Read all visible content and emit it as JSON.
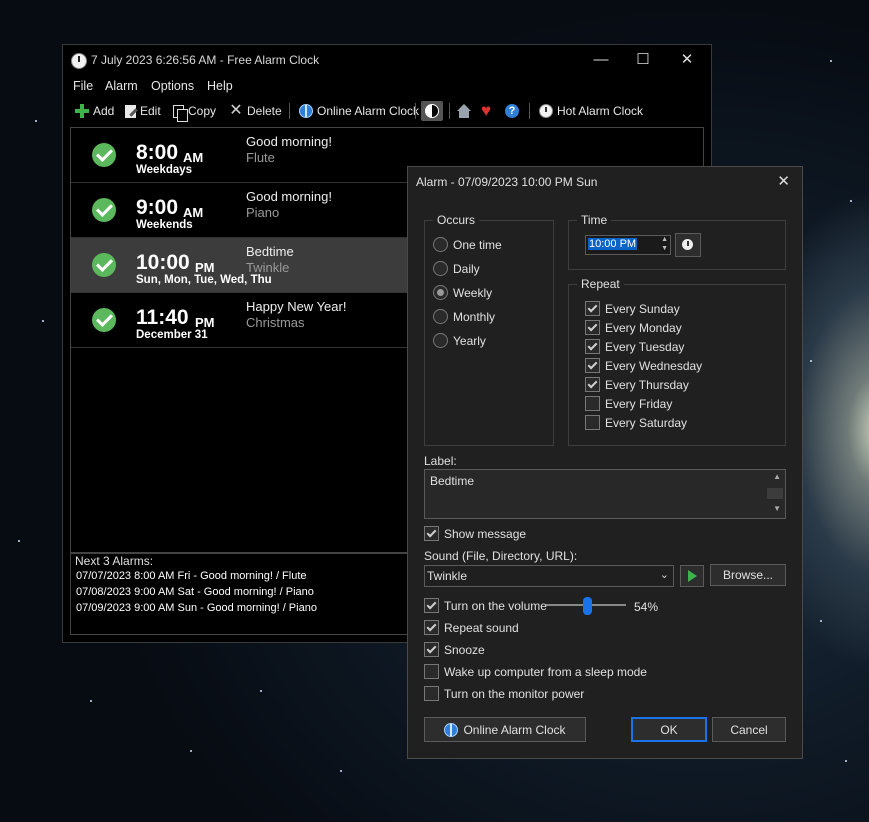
{
  "main_window": {
    "title": "7 July 2023 6:26:56 AM - Free Alarm Clock",
    "controls": {
      "minimize": "—",
      "maximize": "☐",
      "close": "✕"
    },
    "menu": [
      "File",
      "Alarm",
      "Options",
      "Help"
    ],
    "toolbar": {
      "add": "Add",
      "edit": "Edit",
      "copy": "Copy",
      "delete": "Delete",
      "online_alarm_clock": "Online Alarm Clock",
      "hot_alarm_clock": "Hot Alarm Clock"
    },
    "alarms": [
      {
        "time": "8:00",
        "ampm": "AM",
        "days": "Weekdays",
        "label": "Good morning!",
        "sound": "Flute"
      },
      {
        "time": "9:00",
        "ampm": "AM",
        "days": "Weekends",
        "label": "Good morning!",
        "sound": "Piano"
      },
      {
        "time": "10:00",
        "ampm": "PM",
        "days": "Sun, Mon, Tue, Wed, Thu",
        "label": "Bedtime",
        "sound": "Twinkle"
      },
      {
        "time": "11:40",
        "ampm": "PM",
        "days": "December 31",
        "label": "Happy New Year!",
        "sound": "Christmas"
      }
    ],
    "next_alarms": {
      "title": "Next 3 Alarms:",
      "lines": [
        "07/07/2023 8:00 AM Fri - Good morning! / Flute",
        "07/08/2023 9:00 AM Sat - Good morning! / Piano",
        "07/09/2023 9:00 AM Sun - Good morning! / Piano"
      ]
    }
  },
  "dialog": {
    "title": "Alarm - 07/09/2023 10:00 PM Sun",
    "close": "✕",
    "occurs": {
      "title": "Occurs",
      "options": [
        "One time",
        "Daily",
        "Weekly",
        "Monthly",
        "Yearly"
      ],
      "selected": "Weekly"
    },
    "time": {
      "title": "Time",
      "value": "10:00 PM"
    },
    "repeat": {
      "title": "Repeat",
      "days": [
        {
          "label": "Every Sunday",
          "checked": true
        },
        {
          "label": "Every Monday",
          "checked": true
        },
        {
          "label": "Every Tuesday",
          "checked": true
        },
        {
          "label": "Every Wednesday",
          "checked": true
        },
        {
          "label": "Every Thursday",
          "checked": true
        },
        {
          "label": "Every Friday",
          "checked": false
        },
        {
          "label": "Every Saturday",
          "checked": false
        }
      ]
    },
    "label_field": {
      "caption": "Label:",
      "value": "Bedtime"
    },
    "show_message": {
      "label": "Show message",
      "checked": true
    },
    "sound": {
      "caption": "Sound (File, Directory, URL):",
      "value": "Twinkle",
      "browse": "Browse..."
    },
    "volume": {
      "label": "Turn on the volume",
      "checked": true,
      "level_percent": 54,
      "level_text": "54%"
    },
    "repeat_sound": {
      "label": "Repeat sound",
      "checked": true
    },
    "snooze": {
      "label": "Snooze",
      "checked": true
    },
    "wake_up": {
      "label": "Wake up computer from a sleep mode",
      "checked": false
    },
    "monitor_power": {
      "label": "Turn on the monitor power",
      "checked": false
    },
    "buttons": {
      "online": "Online Alarm Clock",
      "ok": "OK",
      "cancel": "Cancel"
    }
  }
}
